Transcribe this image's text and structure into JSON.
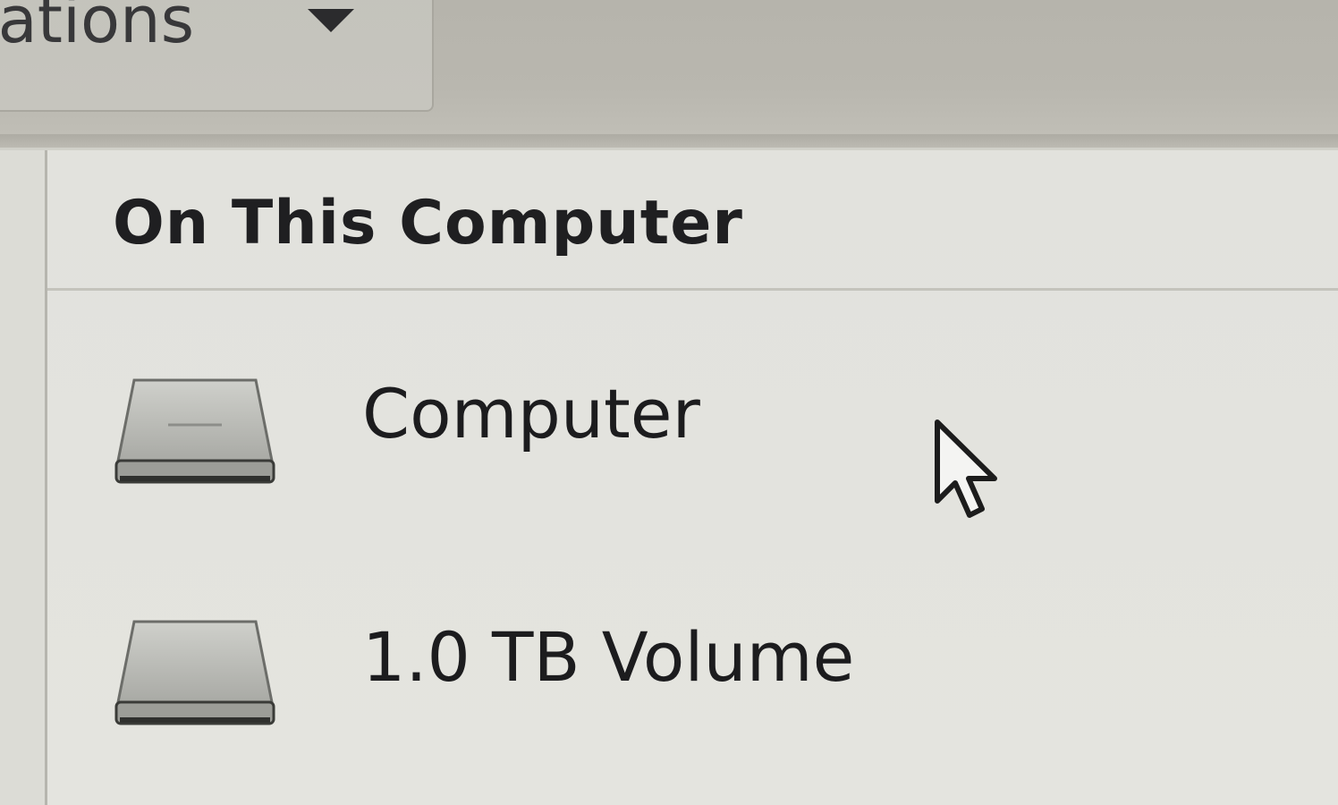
{
  "header": {
    "path_label": "cations",
    "dropdown_icon": "triangle-down-icon"
  },
  "sidebar": {
    "section_title": "On This Computer",
    "items": [
      {
        "label": "Computer",
        "icon": "drive-icon"
      },
      {
        "label": "1.0 TB Volume",
        "icon": "drive-icon"
      }
    ]
  },
  "colors": {
    "header_bg": "#b8b6ae",
    "panel_bg": "#e2e2dd",
    "text": "#1f1f21"
  }
}
